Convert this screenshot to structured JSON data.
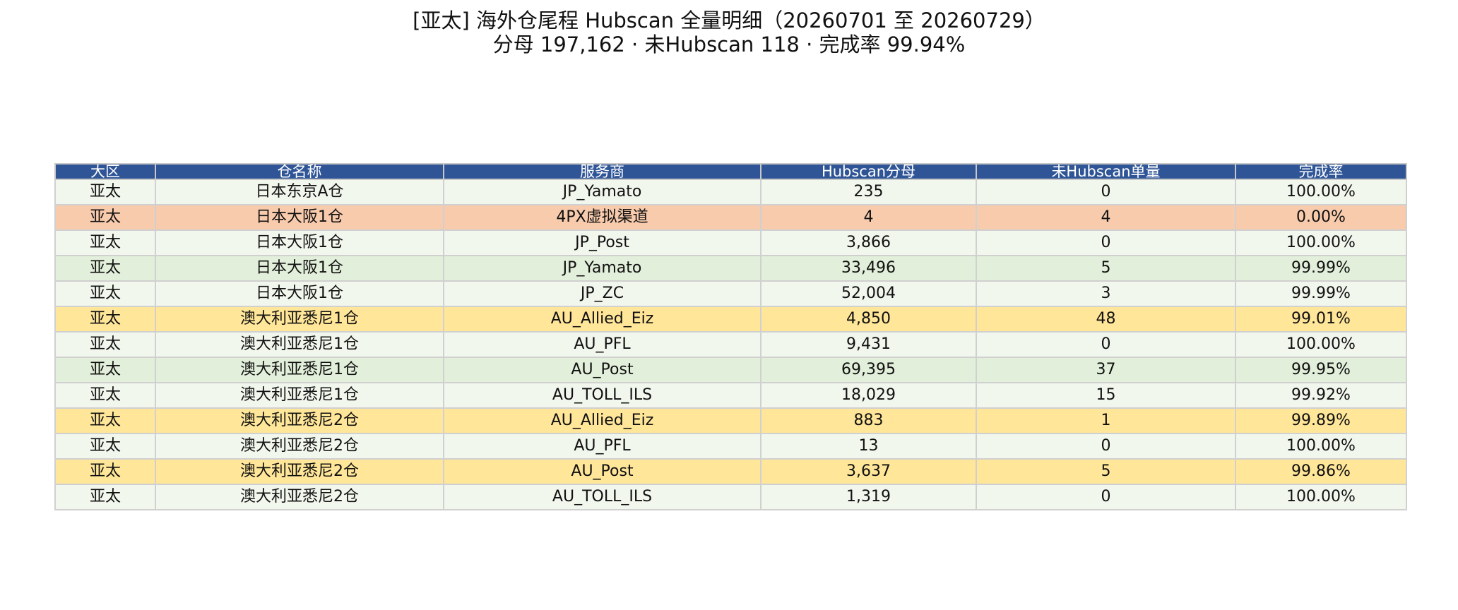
{
  "header": {
    "title": "[亚太] 海外仓尾程 Hubscan 全量明细（20260701 至 20260729）",
    "subtitle": "分母 197,162 · 未Hubscan 118 · 完成率 99.94%"
  },
  "colors": {
    "header_bg": "#2f5597",
    "row_normal": "#f2f7ee",
    "row_alt": "#e2efda",
    "row_warn": "#ffe699",
    "row_bad": "#f8cbad"
  },
  "chart_data": {
    "type": "table",
    "title": "[亚太] 海外仓尾程 Hubscan 全量明细（20260701 至 20260729）",
    "subtitle": "分母 197,162 · 未Hubscan 118 · 完成率 99.94%",
    "columns": [
      "大区",
      "仓名称",
      "服务商",
      "Hubscan分母",
      "未Hubscan单量",
      "完成率"
    ],
    "rows": [
      {
        "region": "亚太",
        "warehouse": "日本东京A仓",
        "carrier": "JP_Yamato",
        "denominator": "235",
        "missing": "0",
        "rate": "100.00%",
        "status": "normal"
      },
      {
        "region": "亚太",
        "warehouse": "日本大阪1仓",
        "carrier": "4PX虚拟渠道",
        "denominator": "4",
        "missing": "4",
        "rate": "0.00%",
        "status": "bad"
      },
      {
        "region": "亚太",
        "warehouse": "日本大阪1仓",
        "carrier": "JP_Post",
        "denominator": "3,866",
        "missing": "0",
        "rate": "100.00%",
        "status": "normal"
      },
      {
        "region": "亚太",
        "warehouse": "日本大阪1仓",
        "carrier": "JP_Yamato",
        "denominator": "33,496",
        "missing": "5",
        "rate": "99.99%",
        "status": "alt"
      },
      {
        "region": "亚太",
        "warehouse": "日本大阪1仓",
        "carrier": "JP_ZC",
        "denominator": "52,004",
        "missing": "3",
        "rate": "99.99%",
        "status": "normal"
      },
      {
        "region": "亚太",
        "warehouse": "澳大利亚悉尼1仓",
        "carrier": "AU_Allied_Eiz",
        "denominator": "4,850",
        "missing": "48",
        "rate": "99.01%",
        "status": "warn"
      },
      {
        "region": "亚太",
        "warehouse": "澳大利亚悉尼1仓",
        "carrier": "AU_PFL",
        "denominator": "9,431",
        "missing": "0",
        "rate": "100.00%",
        "status": "normal"
      },
      {
        "region": "亚太",
        "warehouse": "澳大利亚悉尼1仓",
        "carrier": "AU_Post",
        "denominator": "69,395",
        "missing": "37",
        "rate": "99.95%",
        "status": "alt"
      },
      {
        "region": "亚太",
        "warehouse": "澳大利亚悉尼1仓",
        "carrier": "AU_TOLL_ILS",
        "denominator": "18,029",
        "missing": "15",
        "rate": "99.92%",
        "status": "normal"
      },
      {
        "region": "亚太",
        "warehouse": "澳大利亚悉尼2仓",
        "carrier": "AU_Allied_Eiz",
        "denominator": "883",
        "missing": "1",
        "rate": "99.89%",
        "status": "warn"
      },
      {
        "region": "亚太",
        "warehouse": "澳大利亚悉尼2仓",
        "carrier": "AU_PFL",
        "denominator": "13",
        "missing": "0",
        "rate": "100.00%",
        "status": "normal"
      },
      {
        "region": "亚太",
        "warehouse": "澳大利亚悉尼2仓",
        "carrier": "AU_Post",
        "denominator": "3,637",
        "missing": "5",
        "rate": "99.86%",
        "status": "warn"
      },
      {
        "region": "亚太",
        "warehouse": "澳大利亚悉尼2仓",
        "carrier": "AU_TOLL_ILS",
        "denominator": "1,319",
        "missing": "0",
        "rate": "100.00%",
        "status": "normal"
      }
    ]
  }
}
